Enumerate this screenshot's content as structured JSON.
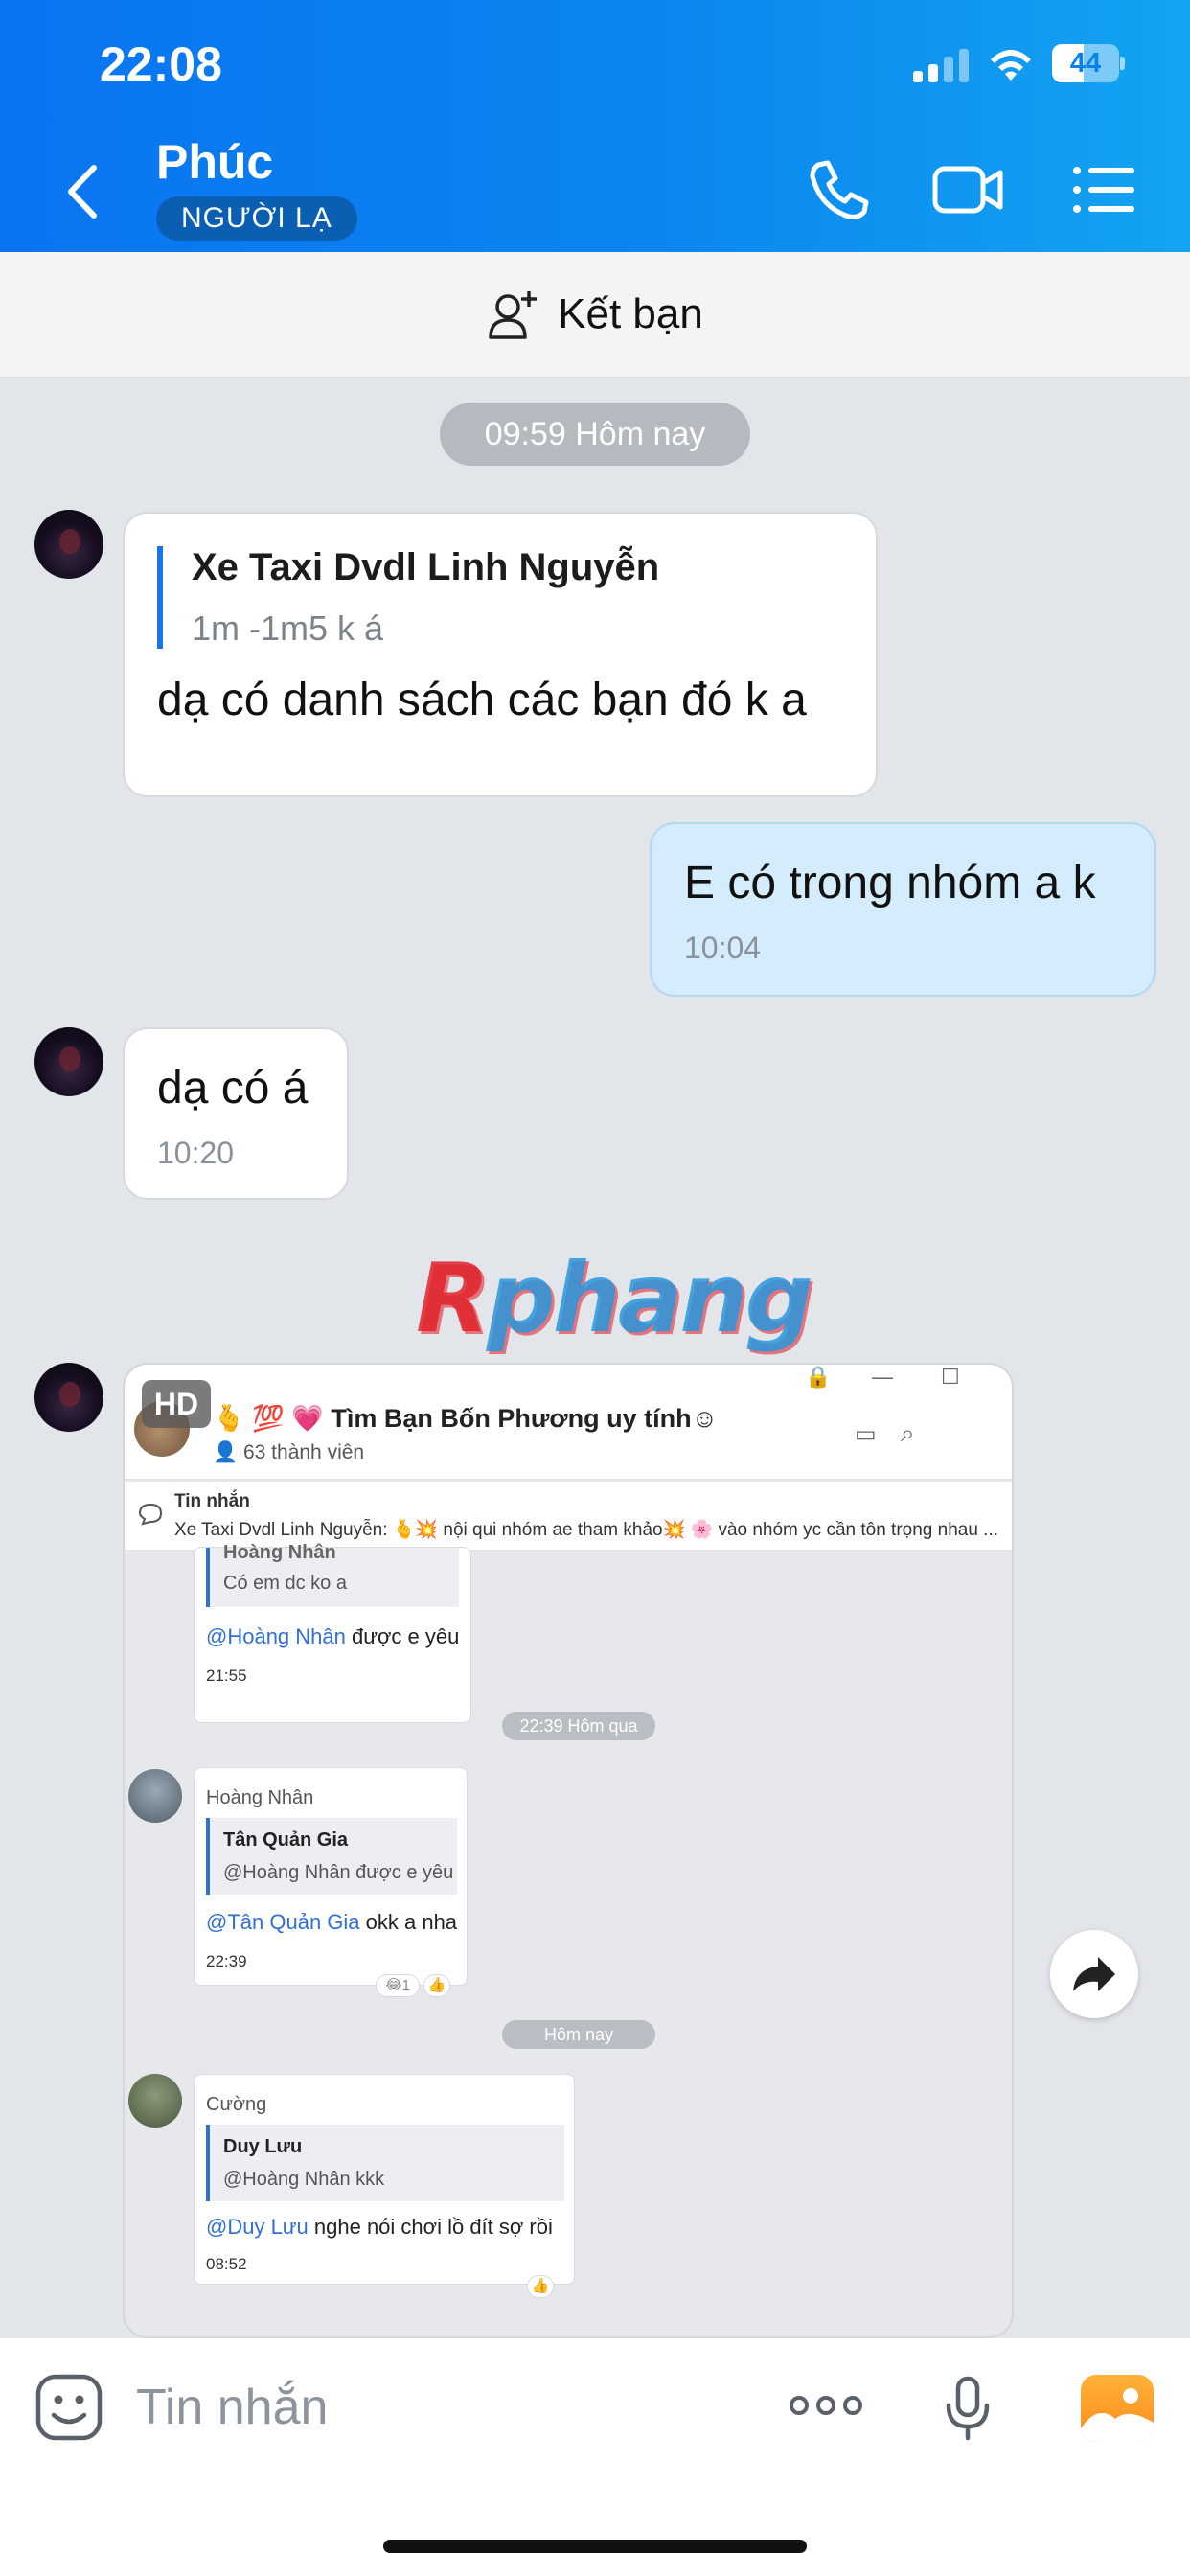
{
  "status_bar": {
    "time": "22:08",
    "battery": "44"
  },
  "header": {
    "contact_name": "Phúc",
    "badge": "NGƯỜI LẠ"
  },
  "add_friend": {
    "label": "Kết bạn"
  },
  "messages": {
    "time_pill_1": "09:59 Hôm nay",
    "m1": {
      "quote_title": "Xe Taxi Dvdl Linh Nguyễn",
      "quote_sub": "1m -1m5 k á",
      "text": "dạ có danh sách các bạn đó k a"
    },
    "m2": {
      "text": "E có trong nhóm a k",
      "time": "10:04"
    },
    "m3": {
      "text": "dạ có á",
      "time": "10:20"
    },
    "watermark": "Rphang"
  },
  "shared_image": {
    "hd": "HD",
    "group_name": "🫰 💯 💗 Tìm Bạn Bốn Phương uy tính☺",
    "members": "63 thành viên",
    "pinned_title": "Tin nhắn",
    "pinned_text": "Xe Taxi Dvdl Linh Nguyễn: 🫰💥 nội qui nhóm ae tham khảo💥 🌸 vào nhóm yc cần tôn trọng nhau ...",
    "c1": {
      "q_title": "Hoàng Nhân",
      "q_text": "Có em dc ko a",
      "mention": "@Hoàng Nhân",
      "text": " được e yêu",
      "time": "21:55"
    },
    "pill_1": "22:39 Hôm qua",
    "c2": {
      "sender": "Hoàng Nhân",
      "q_title": "Tân Quản Gia",
      "q_text": "@Hoàng Nhân được e yêu",
      "mention": "@Tân Quản Gia",
      "text": " okk a nha",
      "time": "22:39",
      "react_count": "1"
    },
    "pill_2": "Hôm nay",
    "c3": {
      "sender": "Cường",
      "q_title": "Duy Lưu",
      "q_text": "@Hoàng Nhân kkk",
      "mention": "@Duy Lưu",
      "text": " nghe nói chơi lồ đít sợ rồi",
      "time": "08:52"
    }
  },
  "composer": {
    "placeholder": "Tin nhắn"
  },
  "colors": {
    "header_blue": "#0a80f0",
    "my_bubble": "#d4ecfc",
    "accent": "#1a74e8"
  },
  "icons": [
    "back-chevron-icon",
    "phone-icon",
    "video-call-icon",
    "menu-list-icon",
    "add-friend-icon",
    "forward-share-icon",
    "emoji-sticker-icon",
    "more-dots-icon",
    "microphone-icon",
    "image-gallery-icon"
  ]
}
